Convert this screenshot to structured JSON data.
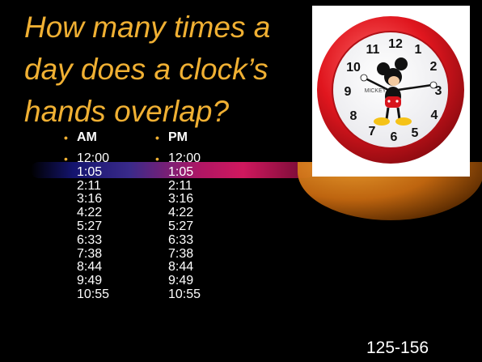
{
  "slide": {
    "title_lines": [
      "How many times a",
      "day does a clock’s",
      "hands overlap?"
    ],
    "clock_image": {
      "icon": "mickey-mouse-clock",
      "brand_text": "MICKEY",
      "numerals": [
        "12",
        "1",
        "2",
        "3",
        "4",
        "5",
        "6",
        "7",
        "8",
        "9",
        "10",
        "11"
      ]
    },
    "am": {
      "heading": "AM",
      "times": [
        "12:00",
        "1:05",
        "2:11",
        "3:16",
        "4:22",
        "5:27",
        "6:33",
        "7:38",
        "8:44",
        "9:49",
        "10:55"
      ]
    },
    "pm": {
      "heading": "PM",
      "times": [
        "12:00",
        "1:05",
        "2:11",
        "3:16",
        "4:22",
        "5:27",
        "6:33",
        "7:38",
        "8:44",
        "9:49",
        "10:55"
      ]
    },
    "slide_number": "125-156",
    "colors": {
      "title": "#f0b033",
      "text": "#ffffff",
      "background": "#000000",
      "clock_rim": "#d8141c"
    }
  }
}
